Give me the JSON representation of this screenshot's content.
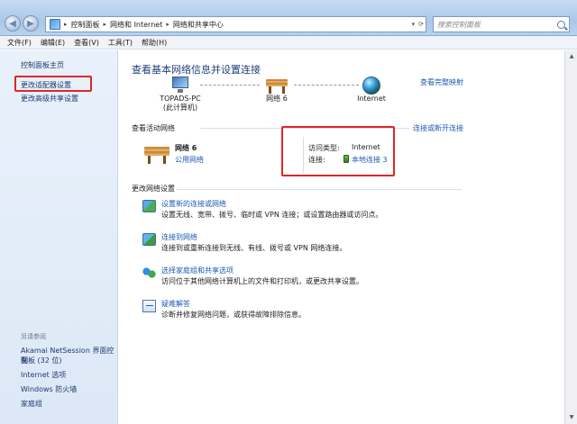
{
  "address": {
    "crumbs": [
      "控制面板",
      "网络和 Internet",
      "网络和共享中心"
    ]
  },
  "search": {
    "placeholder": "搜索控制面板"
  },
  "menu": [
    "文件(F)",
    "编辑(E)",
    "查看(V)",
    "工具(T)",
    "帮助(H)"
  ],
  "sidebar": {
    "home": "控制面板主页",
    "adapter": "更改适配器设置",
    "advanced": "更改高级共享设置",
    "see_also_title": "另请参阅",
    "see_also": [
      "Akamai NetSession 界面控制",
      "面板 (32 位)",
      "Internet 选项",
      "Windows 防火墙",
      "家庭组"
    ]
  },
  "main": {
    "heading": "查看基本网络信息并设置连接",
    "view_full_map": "查看完整映射",
    "map": {
      "computer_name": "TOPADS-PC",
      "computer_sub": "(此计算机)",
      "network": "网络  6",
      "internet": "Internet"
    },
    "active_title": "查看活动网络",
    "connect_or_disconnect": "连接或断开连接",
    "active_network": {
      "name": "网络  6",
      "type": "公用网络",
      "access_label": "访问类型:",
      "access_value": "Internet",
      "conn_label": "连接:",
      "conn_value": "本地连接 3"
    },
    "change_title": "更改网络设置",
    "tasks": [
      {
        "icon": "network-setup-icon",
        "title": "设置新的连接或网络",
        "desc": "设置无线、宽带、拨号、临时或 VPN 连接；或设置路由器或访问点。"
      },
      {
        "icon": "connect-network-icon",
        "title": "连接到网络",
        "desc": "连接到或重新连接到无线、有线、拨号或 VPN 网络连接。"
      },
      {
        "icon": "homegroup-icon",
        "title": "选择家庭组和共享选项",
        "desc": "访问位于其他网络计算机上的文件和打印机，或更改共享设置。"
      },
      {
        "icon": "troubleshoot-icon",
        "title": "疑难解答",
        "desc": "诊断并修复网络问题，或获得故障排除信息。"
      }
    ]
  },
  "highlight_color": "#e0262b"
}
